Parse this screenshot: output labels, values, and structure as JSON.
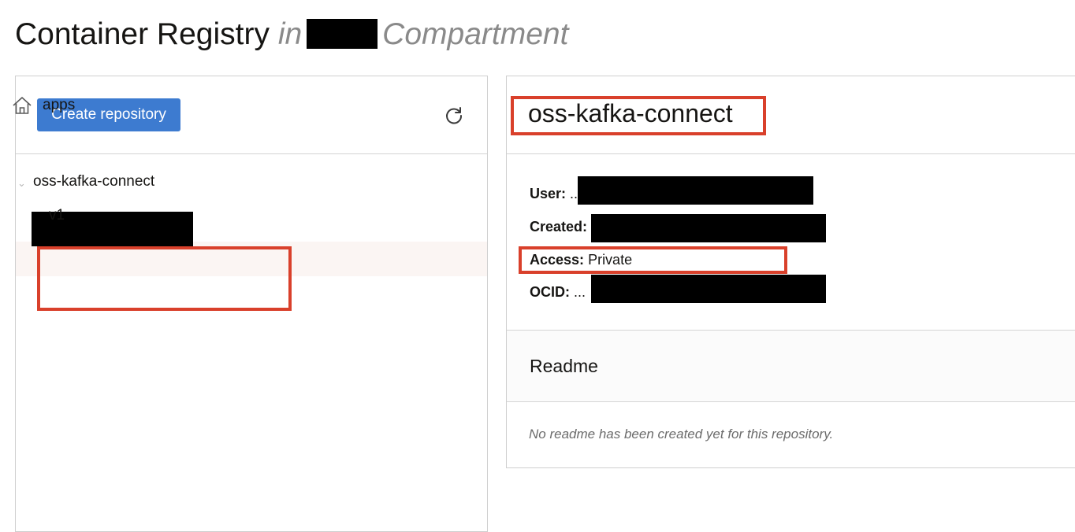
{
  "header": {
    "title": "Container Registry",
    "in_label": "in",
    "compartment_label": "Compartment"
  },
  "toolbar": {
    "create_label": "Create repository",
    "refresh_icon": "refresh-icon"
  },
  "tree": {
    "root_label": "apps",
    "root_icon": "home-icon",
    "repository_label": "oss-kafka-connect",
    "image_tag_label": "v1"
  },
  "details": {
    "title": "oss-kafka-connect",
    "user_label": "User:",
    "user_value": "..",
    "created_label": "Created:",
    "access_label": "Access:",
    "access_value": "Private",
    "ocid_label": "OCID:",
    "ocid_value": "..."
  },
  "readme": {
    "title": "Readme",
    "empty_text": "No readme has been created yet for this repository."
  },
  "colors": {
    "primary_button": "#3d7bd0",
    "highlight_box": "#d9402b",
    "redaction": "#000000"
  }
}
